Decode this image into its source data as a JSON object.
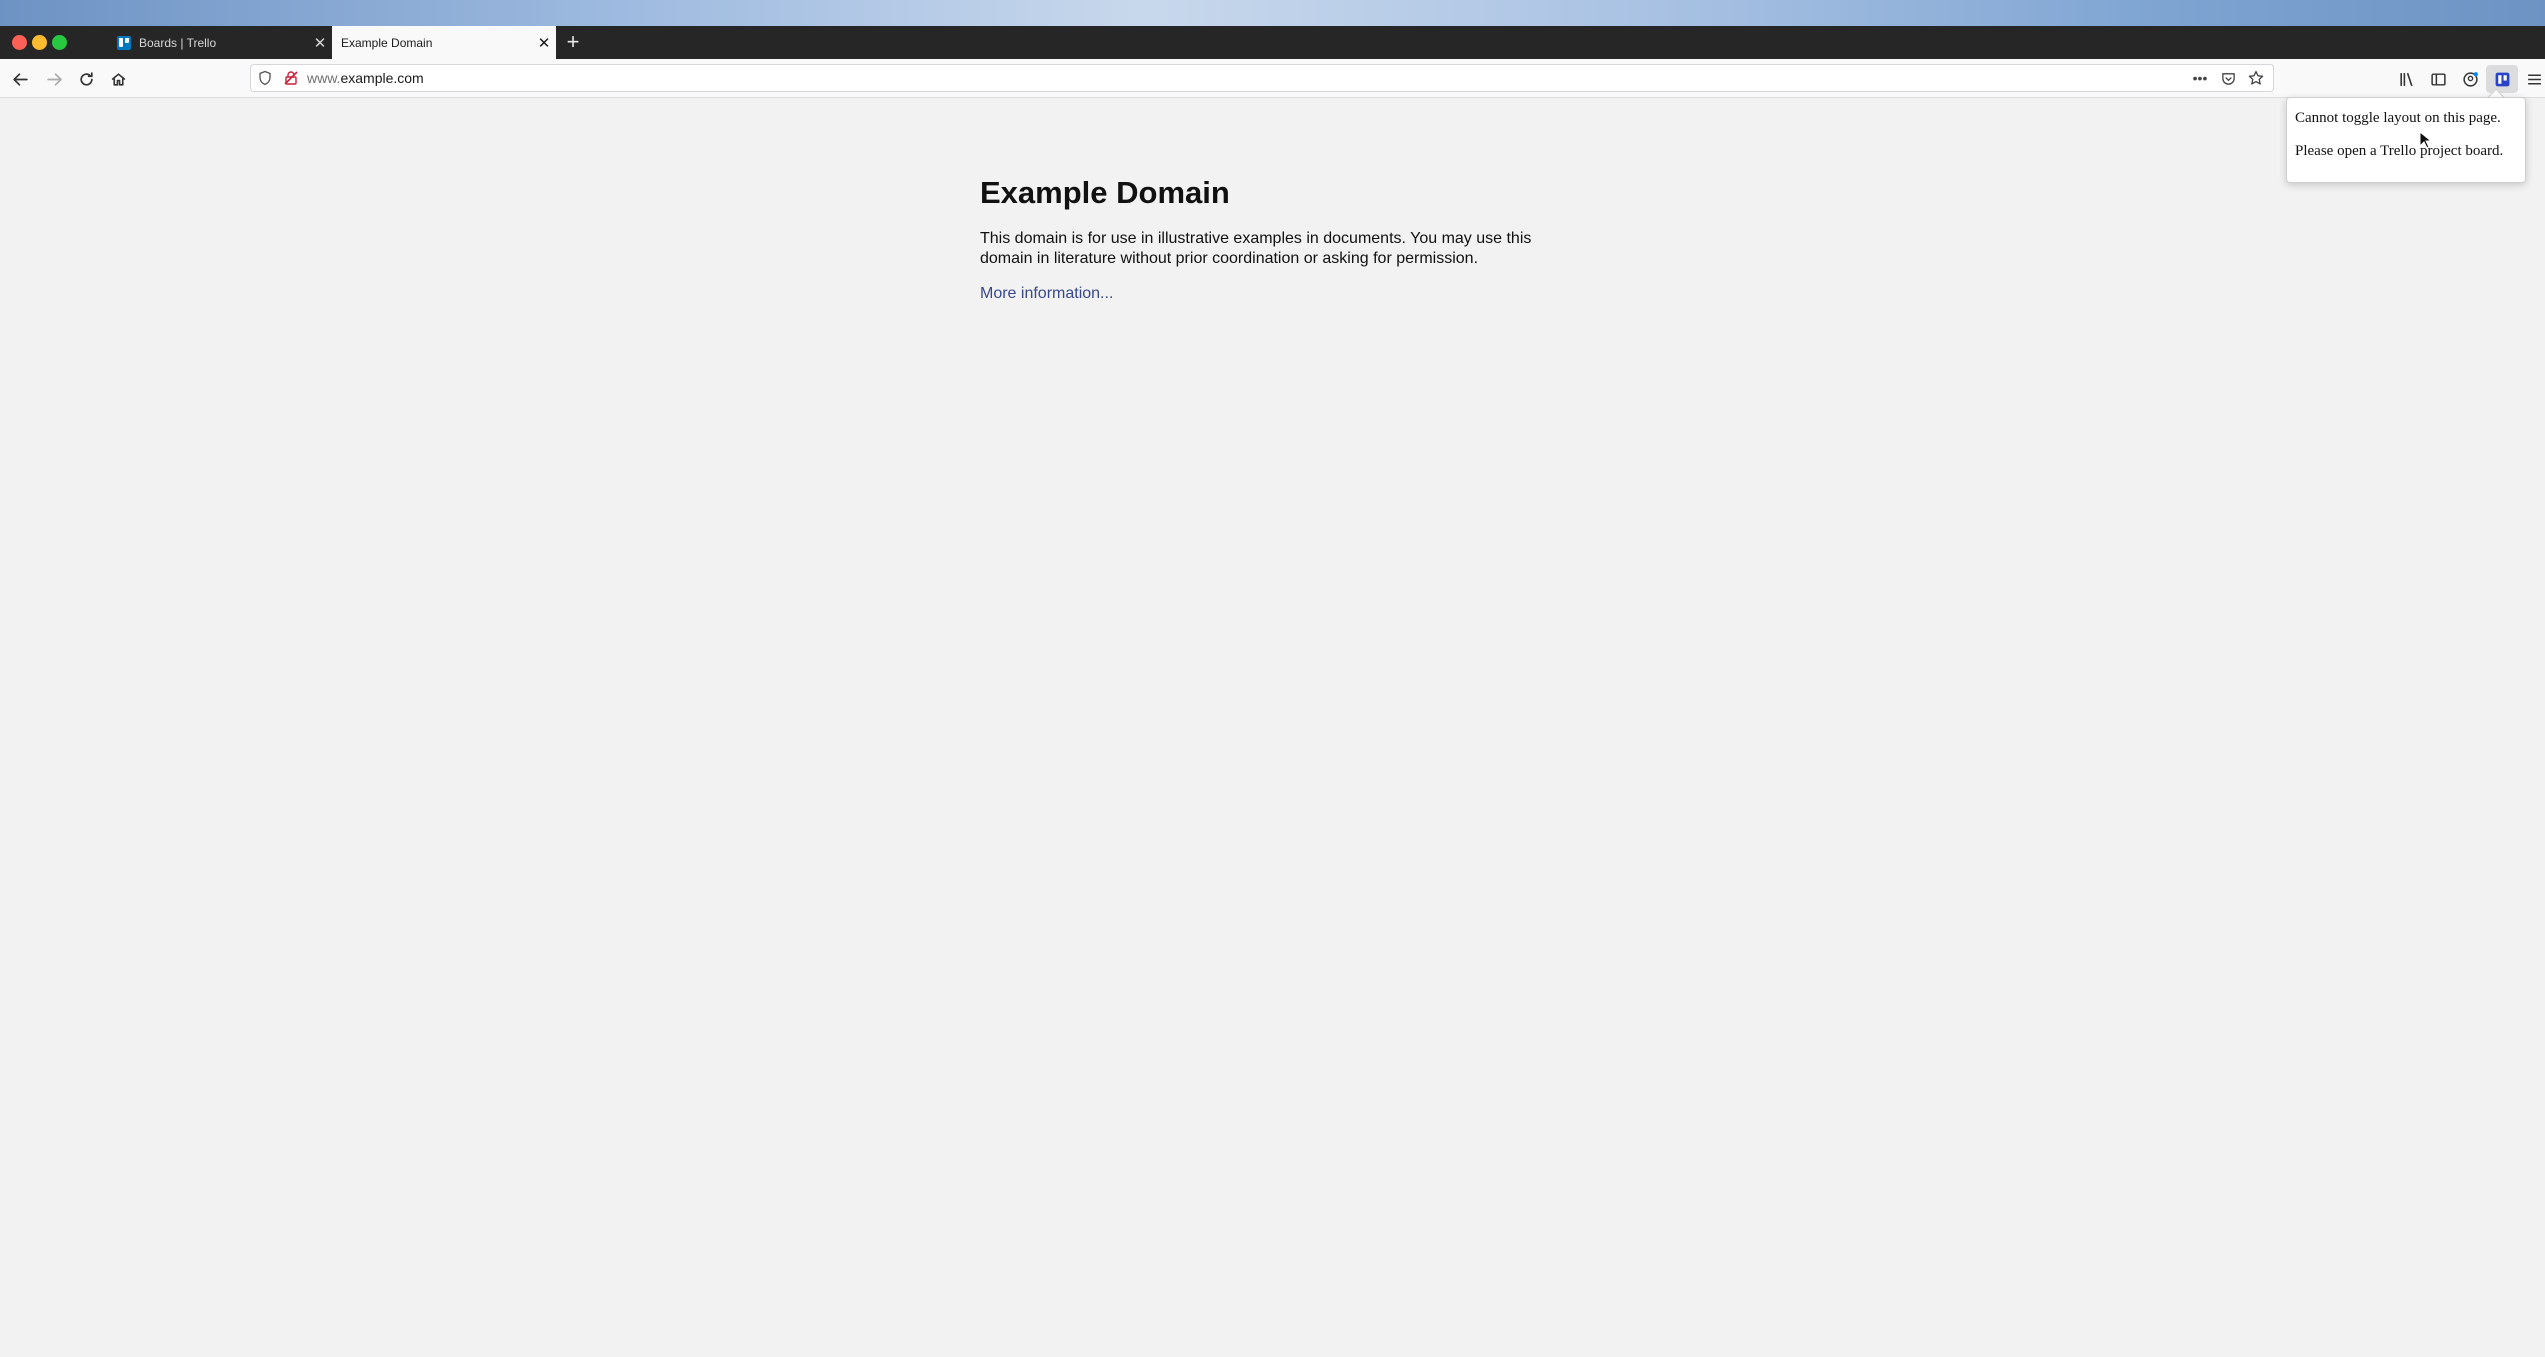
{
  "browser": {
    "tabs": [
      {
        "title": "Boards | Trello",
        "active": false,
        "favicon": "trello-icon"
      },
      {
        "title": "Example Domain",
        "active": true
      }
    ],
    "new_tab_label": "+",
    "url_prefix": "www.",
    "url_domain": "example.com",
    "toolbar_icons": [
      "back-icon",
      "forward-icon",
      "reload-icon",
      "home-icon",
      "library-icon",
      "sidebar-icon",
      "account-icon",
      "extension-icon",
      "menu-icon"
    ]
  },
  "page": {
    "heading": "Example Domain",
    "body": "This domain is for use in illustrative examples in documents. You may use this domain in literature without prior coordination or asking for permission.",
    "link": "More information..."
  },
  "popup": {
    "line1": "Cannot toggle layout on this page.",
    "line2": "Please open a Trello project board."
  },
  "colors": {
    "tabbar": "#262626",
    "link": "#38488f",
    "trello": "#0079bf"
  }
}
